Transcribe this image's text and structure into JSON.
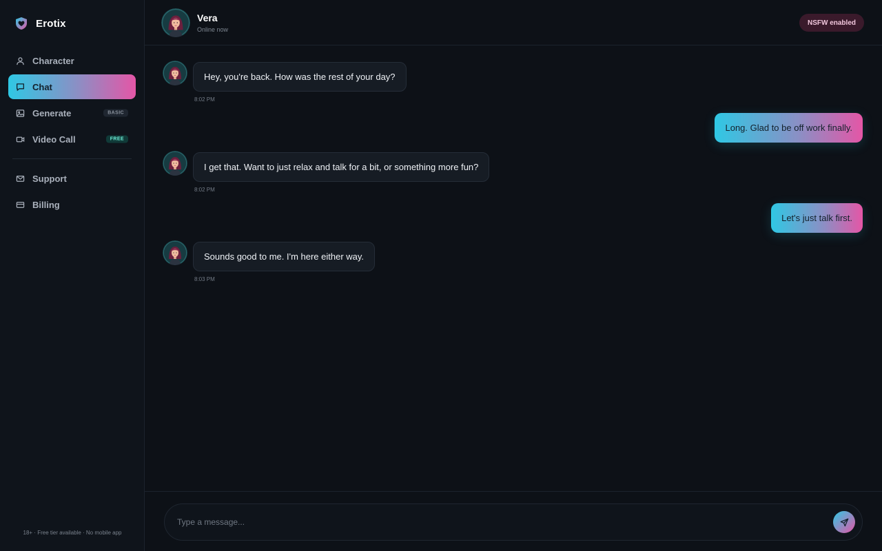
{
  "brand": {
    "name": "Erotix",
    "icon": "heart-shield-icon"
  },
  "sidebar": {
    "items": [
      {
        "label": "Character",
        "icon": "user-icon",
        "active": false,
        "badge": ""
      },
      {
        "label": "Chat",
        "icon": "chat-icon",
        "active": true,
        "badge": ""
      },
      {
        "label": "Generate",
        "icon": "image-icon",
        "active": false,
        "badge": "BASIC"
      },
      {
        "label": "Video Call",
        "icon": "video-icon",
        "active": false,
        "badge": "FREE"
      },
      {
        "label": "Support",
        "icon": "mail-icon",
        "active": false,
        "badge": ""
      },
      {
        "label": "Billing",
        "icon": "card-icon",
        "active": false,
        "badge": ""
      }
    ],
    "footer": "18+ · Free tier available · No mobile app"
  },
  "header": {
    "name": "Vera",
    "status": "Online now",
    "pill": "NSFW enabled"
  },
  "messages": [
    {
      "from": "character",
      "text": "Hey, you're back. How was the rest of your day?",
      "time": "8:02 PM"
    },
    {
      "from": "user",
      "text": "Long. Glad to be off work finally."
    },
    {
      "from": "character",
      "text": "I get that. Want to just relax and talk for a bit, or something more fun?",
      "time": "8:02 PM"
    },
    {
      "from": "user",
      "text": "Let's just talk first."
    },
    {
      "from": "character",
      "text": "Sounds good to me. I'm here either way.",
      "time": "8:03 PM"
    }
  ],
  "composer": {
    "placeholder": "Type a message...",
    "send_icon": "send-icon"
  },
  "colors": {
    "background": "#0d1117",
    "sidebar": "#0f141b",
    "gradient_start": "#2fc8e4",
    "gradient_end": "#e456a6",
    "pill_background": "#3a1a2b"
  }
}
